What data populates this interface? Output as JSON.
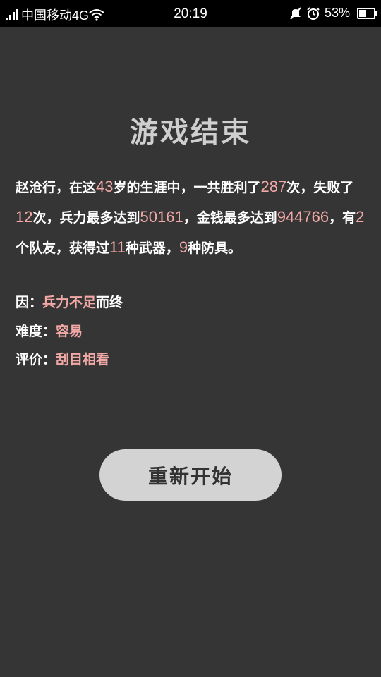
{
  "statusbar": {
    "carrier": "中国移动4G",
    "time": "20:19",
    "battery": "53%",
    "battery_level": 0.53,
    "icons": [
      "signal-icon",
      "wifi-icon",
      "mute-icon",
      "alarm-icon",
      "battery-icon"
    ]
  },
  "title": "游戏结束",
  "summary": {
    "name": "赵沧行",
    "t1": "，在这",
    "age": "43",
    "t2": "岁的生涯中，一共胜利了",
    "wins": "287",
    "t3": "次，失败了",
    "losses": "12",
    "t4": "次，兵力最多达到",
    "max_troops": "50161",
    "t5": "，金钱最多达到",
    "max_money": "944766",
    "t6": "，有",
    "teammates": "2",
    "t7": "个队友，获得过",
    "weapons": "11",
    "t8": "种武器，",
    "armors": "9",
    "t9": "种防具。"
  },
  "cause": {
    "label": "因：",
    "value": "兵力不足",
    "suffix": "而终"
  },
  "difficulty": {
    "label": "难度：",
    "value": "容易"
  },
  "rating": {
    "label": "评价：",
    "value": "刮目相看"
  },
  "restart_button": "重新开始",
  "colors": {
    "background": "#353535",
    "highlight": "#f2a9a6",
    "button": "#d3d3d3"
  }
}
